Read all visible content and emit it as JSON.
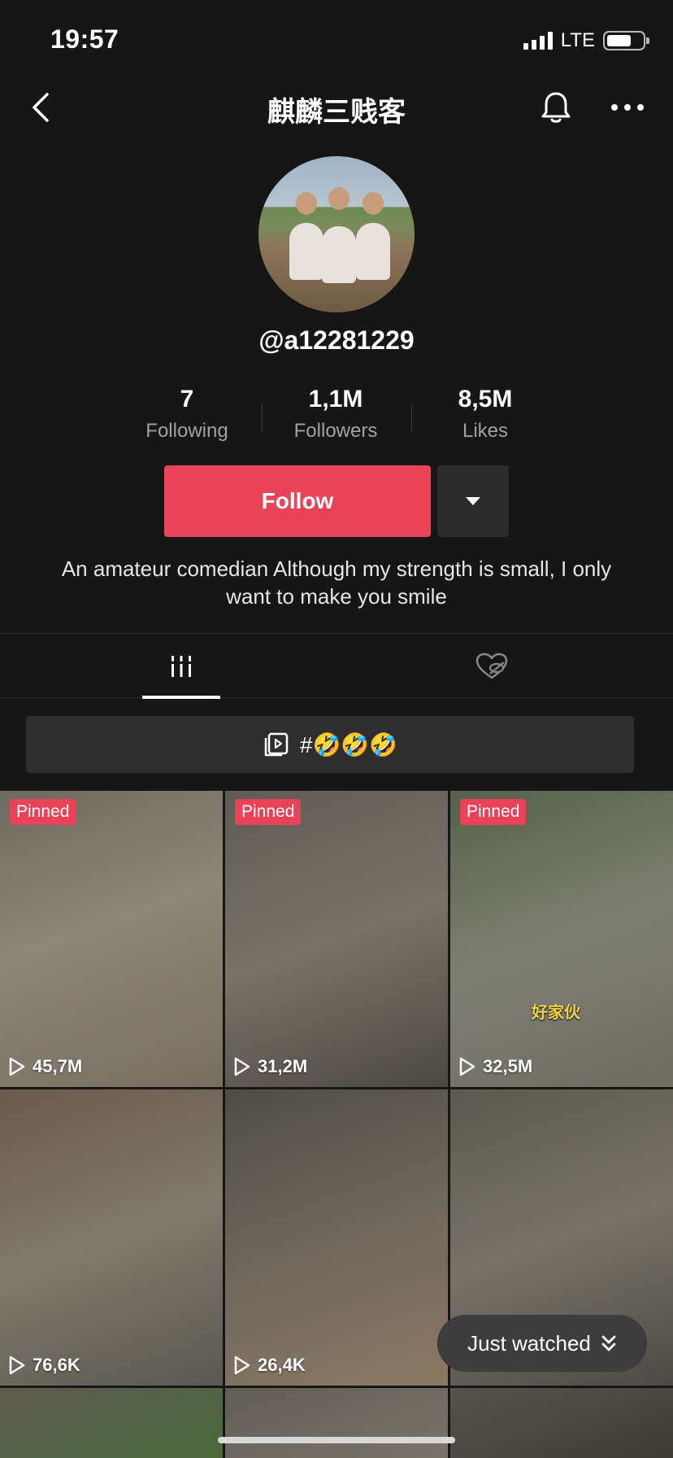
{
  "status_bar": {
    "time": "19:57",
    "network": "LTE",
    "battery_level": 0.7
  },
  "nav": {
    "title": "麒麟三贱客"
  },
  "profile": {
    "username": "@a12281229",
    "stats": [
      {
        "value": "7",
        "label": "Following"
      },
      {
        "value": "1,1M",
        "label": "Followers"
      },
      {
        "value": "8,5M",
        "label": "Likes"
      }
    ],
    "follow_label": "Follow",
    "bio": "An amateur comedian Although my strength is small, I only want to make you smile"
  },
  "playlist": {
    "label": "#🤣🤣🤣"
  },
  "videos": [
    {
      "pinned": "Pinned",
      "views": "45,7M"
    },
    {
      "pinned": "Pinned",
      "views": "31,2M"
    },
    {
      "pinned": "Pinned",
      "views": "32,5M",
      "caption": "好家伙"
    },
    {
      "views": "76,6K"
    },
    {
      "views": "26,4K"
    },
    {
      "views": ""
    }
  ],
  "just_watched": {
    "label": "Just watched"
  },
  "colors": {
    "accent": "#ea4359",
    "background": "#161616"
  }
}
